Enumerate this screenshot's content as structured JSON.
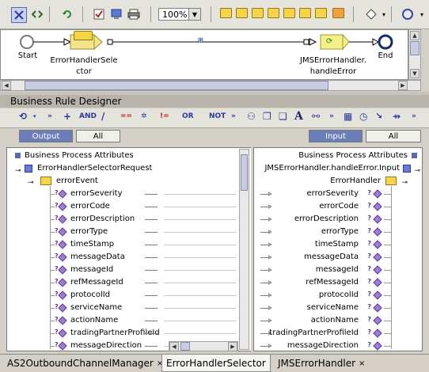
{
  "toolbar": {
    "zoom_value": "100%",
    "icons": [
      "select-icon",
      "connect-icon",
      "refresh-icon",
      "validate-icon",
      "copy-icon",
      "print-icon",
      "zoom-icon",
      "open-folder-icon",
      "folder-1-icon",
      "folder-2-icon",
      "folder-3-icon",
      "folder-4-icon",
      "folder-5-icon",
      "folder-6-icon",
      "folder-7-icon",
      "diamond-icon",
      "circle-icon"
    ]
  },
  "process": {
    "start_label": "Start",
    "node1_label_line1": "ErrorHandlerSele",
    "node1_label_line2": "ctor",
    "link_label": "",
    "node2_label_line1": "JMSErrorHandler.",
    "node2_label_line2": "handleError",
    "end_label": "End"
  },
  "designer": {
    "title": "Business Rule Designer",
    "toolbar_labels": {
      "and": "AND",
      "or": "OR",
      "not": "NOT"
    }
  },
  "left_panel": {
    "tab_output": "Output",
    "tab_all": "All",
    "header": "Business Process Attributes",
    "request": "ErrorHandlerSelectorRequest",
    "event": "errorEvent",
    "fields": [
      "errorSeverity",
      "errorCode",
      "errorDescription",
      "errorType",
      "timeStamp",
      "messageData",
      "messageId",
      "refMessageId",
      "protocolId",
      "serviceName",
      "actionName",
      "tradingPartnerProfileId",
      "messageDirection"
    ]
  },
  "right_panel": {
    "tab_input": "Input",
    "tab_all": "All",
    "header": "Business Process Attributes",
    "input": "JMSErrorHandler.handleError.Input",
    "handler": "ErrorHandler",
    "fields": [
      "errorSeverity",
      "errorCode",
      "errorDescription",
      "errorType",
      "timeStamp",
      "messageData",
      "messageId",
      "refMessageId",
      "protocolId",
      "serviceName",
      "actionName",
      "tradingPartnerProfileId",
      "messageDirection"
    ]
  },
  "bottom_tabs": [
    {
      "label": "AS2OutboundChannelManager",
      "close": "×",
      "selected": false
    },
    {
      "label": "ErrorHandlerSelector",
      "close": "",
      "selected": true
    },
    {
      "label": "JMSErrorHandler",
      "close": "×",
      "selected": false
    }
  ]
}
